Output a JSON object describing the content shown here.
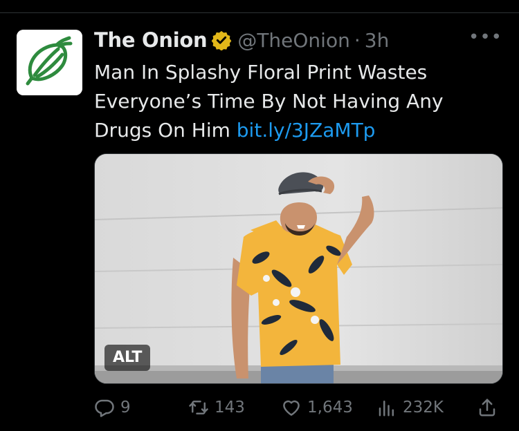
{
  "tweet": {
    "author_name": "The Onion",
    "handle": "@TheOnion",
    "separator": "·",
    "time": "3h",
    "text": "Man In Splashy Floral Print Wastes\nEveryone’s Time By Not Having Any\nDrugs On Him ",
    "link": "bit.ly/3JZaMTp",
    "more_label": "•••",
    "alt_badge": "ALT"
  },
  "actions": {
    "replies": "9",
    "retweets": "143",
    "likes": "1,643",
    "views": "232K"
  },
  "colors": {
    "background": "#000000",
    "text": "#e7e9ea",
    "muted": "#71767b",
    "link": "#1d9bf0",
    "verified": "#e2b719",
    "onion_green": "#2e8b3e"
  },
  "icons": {
    "avatar": "onion-logo",
    "verified": "verified-badge-icon",
    "reply": "reply-icon",
    "retweet": "retweet-icon",
    "like": "heart-icon",
    "views": "views-icon",
    "share": "share-icon"
  }
}
